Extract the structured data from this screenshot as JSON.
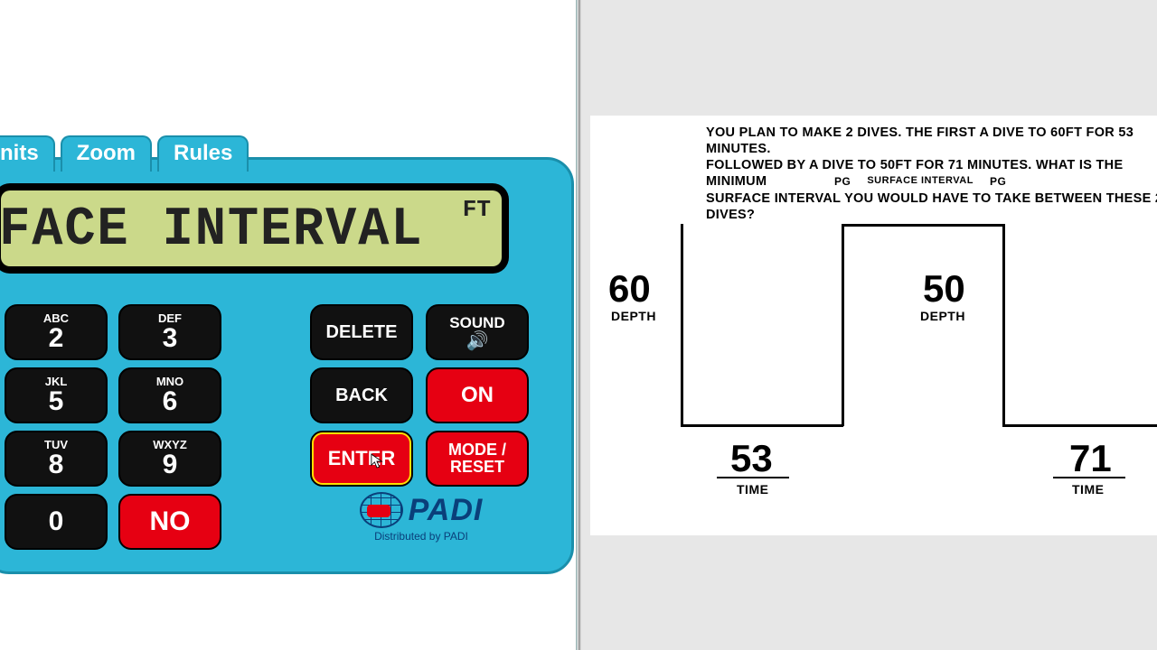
{
  "tabs": {
    "units": "nits",
    "zoom": "Zoom",
    "rules": "Rules"
  },
  "display": {
    "text": "RFACE INTERVAL",
    "unit": "FT"
  },
  "keys": {
    "abc": "ABC",
    "n2": "2",
    "def": "DEF",
    "n3": "3",
    "jkl": "JKL",
    "n5": "5",
    "mno": "MNO",
    "n6": "6",
    "tuv": "TUV",
    "n8": "8",
    "wxyz": "WXYZ",
    "n9": "9",
    "n0": "0",
    "no": "NO",
    "delete": "DELETE",
    "sound": "SOUND",
    "back": "BACK",
    "on": "ON",
    "enter": "ENTER",
    "mode": "MODE /\nRESET"
  },
  "logo": {
    "brand": "PADI",
    "sub": "Distributed by PADI"
  },
  "problem": {
    "line1": "YOU PLAN TO MAKE 2 DIVES. THE FIRST A DIVE TO 60FT FOR 53 MINUTES.",
    "line2": "FOLLOWED BY A DIVE TO 50FT FOR 71 MINUTES. WHAT IS THE MINIMUM",
    "line3": "SURFACE INTERVAL YOU WOULD HAVE TO TAKE BETWEEN THESE 2 DIVES?",
    "pg1": "PG",
    "si": "SURFACE INTERVAL",
    "pg2": "PG"
  },
  "profile": {
    "depth1": "60",
    "depth1_lbl": "DEPTH",
    "depth2": "50",
    "depth2_lbl": "DEPTH",
    "time1": "53",
    "time1_lbl": "TIME",
    "time2": "71",
    "time2_lbl": "TIME"
  }
}
